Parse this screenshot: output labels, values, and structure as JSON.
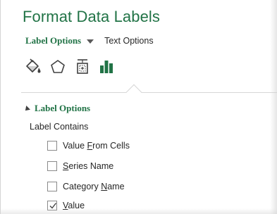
{
  "pane": {
    "title": "Format Data Labels",
    "options": {
      "active_label": "Label Options",
      "text_label": "Text Options"
    },
    "icons": [
      {
        "name": "fill-line-icon"
      },
      {
        "name": "effects-icon"
      },
      {
        "name": "size-properties-icon"
      },
      {
        "name": "label-options-icon"
      }
    ],
    "section": {
      "title": "Label Options",
      "sub_label": "Label Contains",
      "checkboxes": [
        {
          "pre": "Value ",
          "accel": "F",
          "post": "rom Cells",
          "checked": false
        },
        {
          "pre": "",
          "accel": "S",
          "post": "eries Name",
          "checked": false
        },
        {
          "pre": "Category ",
          "accel": "N",
          "post": "ame",
          "checked": false
        },
        {
          "pre": "",
          "accel": "V",
          "post": "alue",
          "checked": true
        }
      ]
    }
  },
  "colors": {
    "accent": "#217346",
    "text": "#262626",
    "checkbox_border": "#8a8a8a"
  }
}
